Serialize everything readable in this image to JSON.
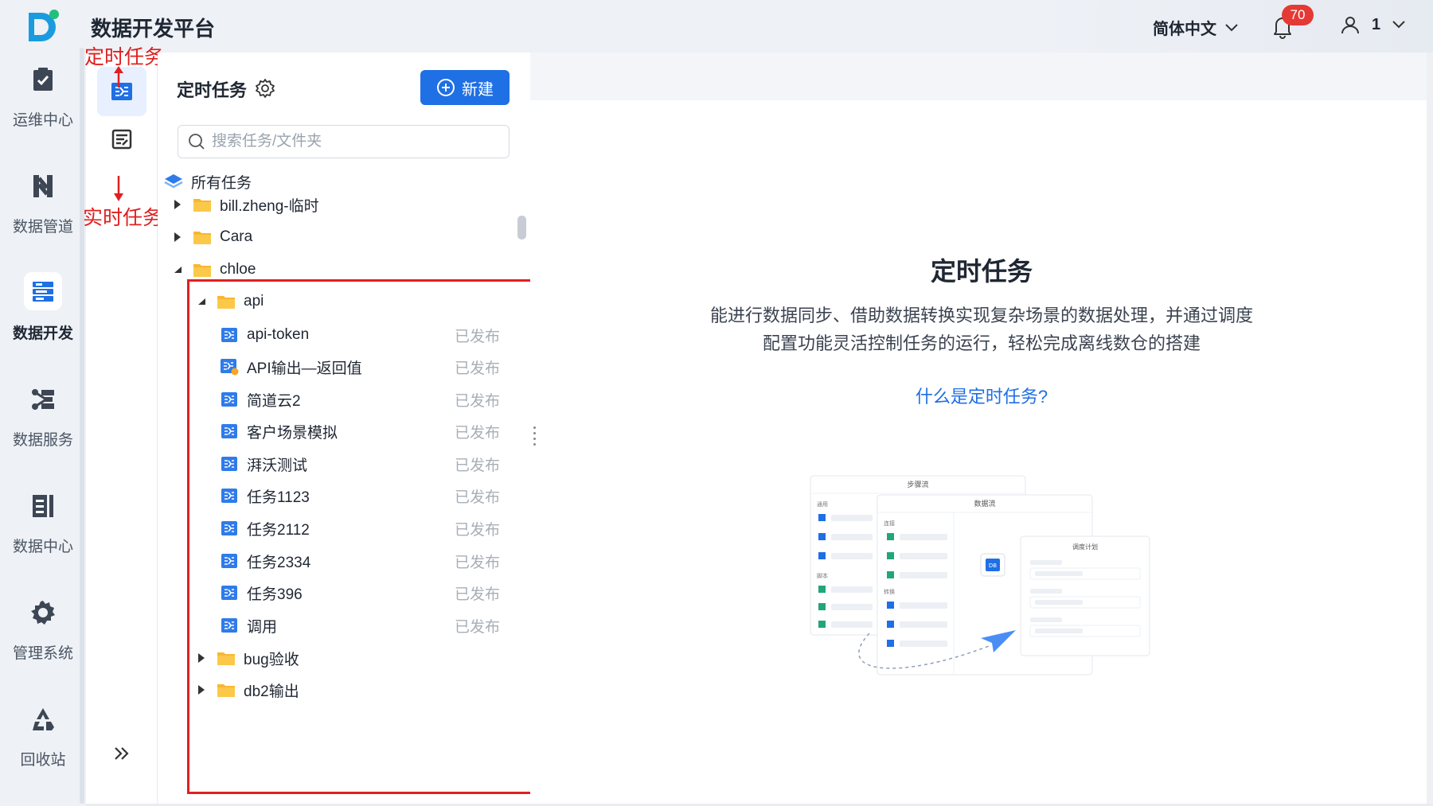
{
  "app": {
    "title": "数据开发平台"
  },
  "nav": [
    {
      "label": "运维中心",
      "icon": "clipboard-check-icon",
      "active": false
    },
    {
      "label": "数据管道",
      "icon": "pipeline-icon",
      "active": false
    },
    {
      "label": "数据开发",
      "icon": "data-dev-icon",
      "active": true
    },
    {
      "label": "数据服务",
      "icon": "data-service-icon",
      "active": false
    },
    {
      "label": "数据中心",
      "icon": "data-center-icon",
      "active": false
    },
    {
      "label": "管理系统",
      "icon": "gear-icon",
      "active": false
    },
    {
      "label": "回收站",
      "icon": "recycle-icon",
      "active": false
    }
  ],
  "header": {
    "language": "简体中文",
    "notification_count": "70",
    "user_name": "1"
  },
  "annotations": {
    "scheduled": "定时任务",
    "realtime": "实时任务"
  },
  "panel": {
    "title": "定时任务",
    "new_button": "新建",
    "search_placeholder": "搜索任务/文件夹",
    "tree": [
      {
        "label": "所有任务",
        "type": "root",
        "depth": 0,
        "arrow": "none"
      },
      {
        "label": "bill.zheng-临时",
        "type": "folder",
        "depth": 1,
        "arrow": "collapsed"
      },
      {
        "label": "Cara",
        "type": "folder",
        "depth": 1,
        "arrow": "collapsed"
      },
      {
        "label": "chloe",
        "type": "folder",
        "depth": 1,
        "arrow": "expanded"
      },
      {
        "label": "api",
        "type": "folder",
        "depth": 2,
        "arrow": "expanded"
      },
      {
        "label": "api-token",
        "type": "task",
        "depth": 3,
        "status": "已发布"
      },
      {
        "label": "API输出—返回值",
        "type": "task-warn",
        "depth": 3,
        "status": "已发布"
      },
      {
        "label": "简道云2",
        "type": "task",
        "depth": 3,
        "status": "已发布"
      },
      {
        "label": "客户场景模拟",
        "type": "task",
        "depth": 3,
        "status": "已发布"
      },
      {
        "label": "湃沃测试",
        "type": "task",
        "depth": 3,
        "status": "已发布"
      },
      {
        "label": "任务1123",
        "type": "task",
        "depth": 3,
        "status": "已发布"
      },
      {
        "label": "任务2112",
        "type": "task",
        "depth": 3,
        "status": "已发布"
      },
      {
        "label": "任务2334",
        "type": "task",
        "depth": 3,
        "status": "已发布"
      },
      {
        "label": "任务396",
        "type": "task",
        "depth": 3,
        "status": "已发布"
      },
      {
        "label": "调用",
        "type": "task",
        "depth": 3,
        "status": "已发布"
      },
      {
        "label": "bug验收",
        "type": "folder",
        "depth": 2,
        "arrow": "collapsed"
      },
      {
        "label": "db2输出",
        "type": "folder",
        "depth": 2,
        "arrow": "collapsed"
      }
    ]
  },
  "intro": {
    "title": "定时任务",
    "description": "能进行数据同步、借助数据转换实现复杂场景的数据处理，并通过调度配置功能灵活控制任务的运行，轻松完成离线数仓的搭建",
    "link": "什么是定时任务?"
  },
  "illustration": {
    "card1_title": "步骤流",
    "card2_title": "数据流",
    "card3_title": "调度计划",
    "label_general": "通用",
    "label_script": "脚本",
    "label_connect": "连接",
    "label_transform": "转换",
    "db_tag": "DB"
  },
  "colors": {
    "accent": "#1f6fe5",
    "annotation": "#e02020",
    "folder": "#f7b733",
    "badge": "#e53935"
  }
}
